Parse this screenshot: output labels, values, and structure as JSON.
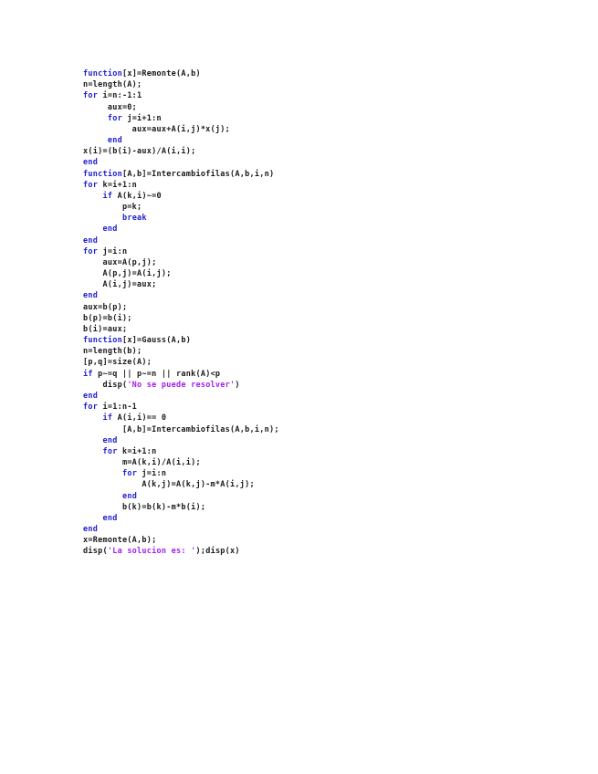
{
  "colors": {
    "keyword": "#1f1fd0",
    "string": "#a020f0",
    "text": "#1a1a1a",
    "background": "#ffffff"
  },
  "lines": [
    [
      {
        "k": "function",
        "t": "kw"
      },
      {
        "k": "[x]=Remonte(A,b)"
      }
    ],
    [
      {
        "k": "n=length(A);"
      }
    ],
    [
      {
        "k": "for",
        "t": "kw"
      },
      {
        "k": " i=n:-1:1"
      }
    ],
    [
      {
        "k": "     aux=0;"
      }
    ],
    [
      {
        "k": "     "
      },
      {
        "k": "for",
        "t": "kw"
      },
      {
        "k": " j=i+1:n"
      }
    ],
    [
      {
        "k": "          aux=aux+A(i,j)*x(j);"
      }
    ],
    [
      {
        "k": "     "
      },
      {
        "k": "end",
        "t": "kw"
      }
    ],
    [
      {
        "k": "x(i)=(b(i)-aux)/A(i,i);"
      }
    ],
    [
      {
        "k": "end",
        "t": "kw"
      }
    ],
    [
      {
        "k": "function",
        "t": "kw"
      },
      {
        "k": "[A,b]=Intercambiofilas(A,b,i,n)"
      }
    ],
    [
      {
        "k": "for",
        "t": "kw"
      },
      {
        "k": " k=i+1:n"
      }
    ],
    [
      {
        "k": "    "
      },
      {
        "k": "if",
        "t": "kw"
      },
      {
        "k": " A(k,i)~=0"
      }
    ],
    [
      {
        "k": "        p=k;"
      }
    ],
    [
      {
        "k": "        "
      },
      {
        "k": "break",
        "t": "kw"
      }
    ],
    [
      {
        "k": "    "
      },
      {
        "k": "end",
        "t": "kw"
      }
    ],
    [
      {
        "k": "end",
        "t": "kw"
      }
    ],
    [
      {
        "k": "for",
        "t": "kw"
      },
      {
        "k": " j=i:n"
      }
    ],
    [
      {
        "k": "    aux=A(p,j);"
      }
    ],
    [
      {
        "k": "    A(p,j)=A(i,j);"
      }
    ],
    [
      {
        "k": "    A(i,j)=aux;"
      }
    ],
    [
      {
        "k": "end",
        "t": "kw"
      }
    ],
    [
      {
        "k": "aux=b(p);"
      }
    ],
    [
      {
        "k": "b(p)=b(i);"
      }
    ],
    [
      {
        "k": "b(i)=aux;"
      }
    ],
    [
      {
        "k": "function",
        "t": "kw"
      },
      {
        "k": "[x]=Gauss(A,b)"
      }
    ],
    [
      {
        "k": "n=length(b);"
      }
    ],
    [
      {
        "k": "[p,q]=size(A);"
      }
    ],
    [
      {
        "k": "if",
        "t": "kw"
      },
      {
        "k": " p~=q || p~=n || rank(A)<p"
      }
    ],
    [
      {
        "k": "    disp("
      },
      {
        "k": "'No se puede resolver'",
        "t": "str"
      },
      {
        "k": ")"
      }
    ],
    [
      {
        "k": "end",
        "t": "kw"
      }
    ],
    [
      {
        "k": "for",
        "t": "kw"
      },
      {
        "k": " i=1:n-1"
      }
    ],
    [
      {
        "k": "    "
      },
      {
        "k": "if",
        "t": "kw"
      },
      {
        "k": " A(i,i)== 0"
      }
    ],
    [
      {
        "k": "        [A,b]=Intercambiofilas(A,b,i,n);"
      }
    ],
    [
      {
        "k": "    "
      },
      {
        "k": "end",
        "t": "kw"
      }
    ],
    [
      {
        "k": "    "
      },
      {
        "k": "for",
        "t": "kw"
      },
      {
        "k": " k=i+1:n"
      }
    ],
    [
      {
        "k": "        m=A(k,i)/A(i,i);"
      }
    ],
    [
      {
        "k": "        "
      },
      {
        "k": "for",
        "t": "kw"
      },
      {
        "k": " j=i:n"
      }
    ],
    [
      {
        "k": "            A(k,j)=A(k,j)-m*A(i,j);"
      }
    ],
    [
      {
        "k": "        "
      },
      {
        "k": "end",
        "t": "kw"
      }
    ],
    [
      {
        "k": "        b(k)=b(k)-m*b(i);"
      }
    ],
    [
      {
        "k": "    "
      },
      {
        "k": "end",
        "t": "kw"
      }
    ],
    [
      {
        "k": "end",
        "t": "kw"
      }
    ],
    [
      {
        "k": "x=Remonte(A,b);"
      }
    ],
    [
      {
        "k": "disp("
      },
      {
        "k": "'La solucion es: '",
        "t": "str"
      },
      {
        "k": ");disp(x)"
      }
    ]
  ]
}
